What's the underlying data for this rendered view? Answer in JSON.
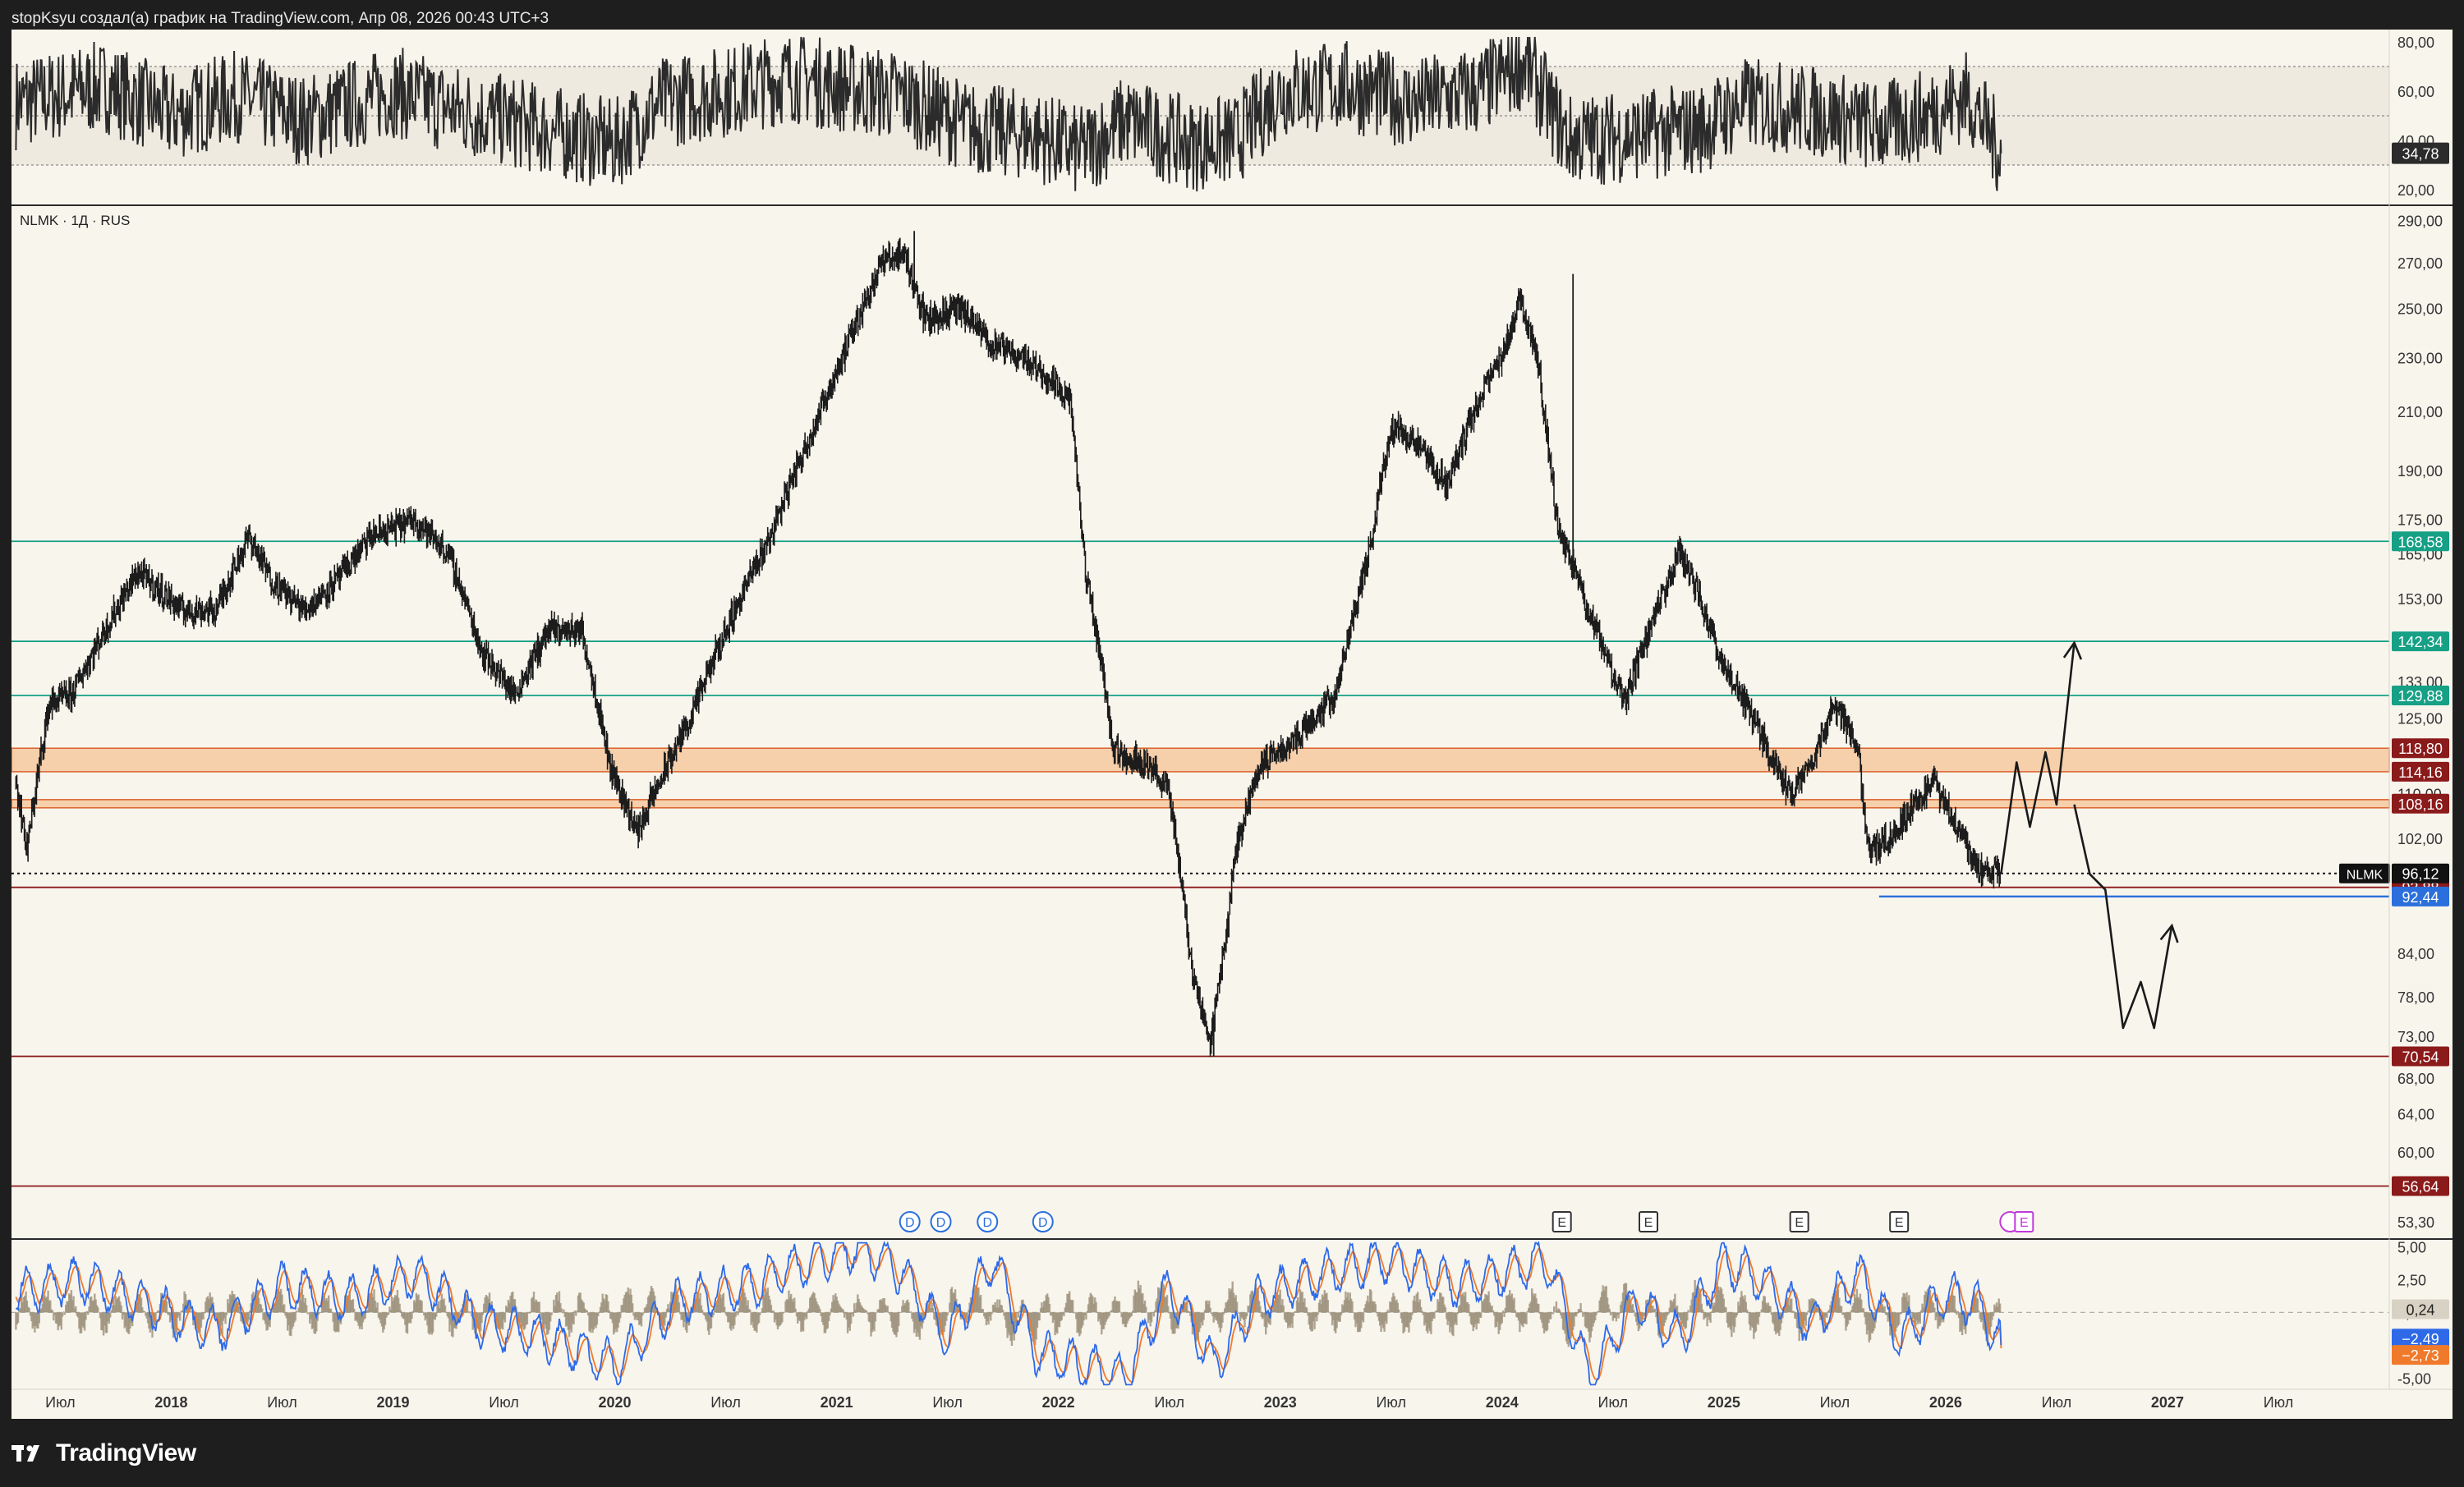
{
  "header": {
    "text": "stopKsyu создал(а) график на TradingView.com, Апр 08, 2026 00:43 UTC+3"
  },
  "footer": {
    "brand": "TradingView"
  },
  "main_legend": "NLMK · 1Д · RUS",
  "colors": {
    "background": "#f8f5ed",
    "candles": "#1c1c1c",
    "support_teal": "#16a085",
    "resistance_red": "#8b1a1a",
    "zone_orange": "#f5a15c",
    "blue_line": "#2a6fdb",
    "macd_line": "#2e6ae8",
    "signal_line": "#f07a2b",
    "histogram": "#9b9079"
  },
  "chart_data": [
    {
      "type": "line",
      "panel": "rsi",
      "y_ticks": [
        "80,00",
        "60,00",
        "40,00",
        "20,00"
      ],
      "ylim": [
        15,
        85
      ],
      "bands": [
        70,
        50,
        30
      ],
      "current_label": "34,78",
      "current_value": 34.78,
      "anchors_x": [
        2017.3,
        2017.7,
        2018.0,
        2018.3,
        2018.6,
        2019.0,
        2019.3,
        2019.6,
        2020.0,
        2020.2,
        2020.5,
        2020.8,
        2021.0,
        2021.3,
        2021.6,
        2021.9,
        2022.1,
        2022.3,
        2022.6,
        2022.8,
        2023.0,
        2023.3,
        2023.6,
        2023.9,
        2024.1,
        2024.3,
        2024.6,
        2024.9,
        2025.1,
        2025.4,
        2025.7,
        2025.9,
        2026.1,
        2026.25
      ],
      "anchors_y": [
        55,
        62,
        50,
        58,
        48,
        60,
        52,
        46,
        38,
        55,
        60,
        66,
        62,
        58,
        45,
        42,
        35,
        48,
        38,
        40,
        60,
        62,
        55,
        60,
        72,
        40,
        42,
        45,
        55,
        52,
        45,
        50,
        58,
        34.78
      ]
    },
    {
      "type": "candlestick",
      "panel": "price",
      "symbol": "NLMK",
      "timeframe": "1Д",
      "exchange": "RUS",
      "y_ticks": [
        "290,00",
        "270,00",
        "250,00",
        "230,00",
        "210,00",
        "190,00",
        "175,00",
        "165,00",
        "153,00",
        "143,00",
        "133,00",
        "125,00",
        "110,00",
        "102,00",
        "84,00",
        "78,00",
        "73,00",
        "68,00",
        "64,00",
        "60,00",
        "53,30"
      ],
      "y_tick_values": [
        290,
        270,
        250,
        230,
        210,
        190,
        175,
        165,
        153,
        143,
        133,
        125,
        110,
        102,
        84,
        78,
        73,
        68,
        64,
        60,
        53.3
      ],
      "ylim": [
        52,
        296
      ],
      "scale": "log",
      "x_ticks": [
        "Июл",
        "2018",
        "Июл",
        "2019",
        "Июл",
        "2020",
        "Июл",
        "2021",
        "Июл",
        "2022",
        "Июл",
        "2023",
        "Июл",
        "2024",
        "Июл",
        "2025",
        "Июл",
        "2026",
        "Июл",
        "2027",
        "Июл"
      ],
      "x_tick_values": [
        2017.5,
        2018.0,
        2018.5,
        2019.0,
        2019.5,
        2020.0,
        2020.5,
        2021.0,
        2021.5,
        2022.0,
        2022.5,
        2023.0,
        2023.5,
        2024.0,
        2024.5,
        2025.0,
        2025.5,
        2026.0,
        2026.5,
        2027.0,
        2027.5
      ],
      "x_bold": [
        false,
        true,
        false,
        true,
        false,
        true,
        false,
        true,
        false,
        true,
        false,
        true,
        false,
        true,
        false,
        true,
        false,
        true,
        false,
        true,
        false
      ],
      "xlim": [
        2017.28,
        2028.0
      ],
      "current": {
        "symbol": "NLMK",
        "label": "96,12",
        "value": 96.12
      },
      "anchors_x": [
        2017.3,
        2017.35,
        2017.45,
        2017.55,
        2017.7,
        2017.85,
        2018.05,
        2018.2,
        2018.35,
        2018.45,
        2018.6,
        2018.75,
        2018.9,
        2019.1,
        2019.25,
        2019.4,
        2019.55,
        2019.7,
        2019.85,
        2019.98,
        2020.1,
        2020.2,
        2020.35,
        2020.5,
        2020.7,
        2020.9,
        2021.05,
        2021.2,
        2021.3,
        2021.4,
        2021.55,
        2021.7,
        2021.85,
        2022.05,
        2022.12,
        2022.16,
        2022.25,
        2022.4,
        2022.5,
        2022.6,
        2022.68,
        2022.75,
        2022.8,
        2022.9,
        2023.05,
        2023.25,
        2023.4,
        2023.5,
        2023.6,
        2023.75,
        2023.9,
        2024.0,
        2024.08,
        2024.16,
        2024.22,
        2024.25,
        2024.3,
        2024.4,
        2024.55,
        2024.7,
        2024.8,
        2024.9,
        2025.0,
        2025.1,
        2025.2,
        2025.3,
        2025.4,
        2025.5,
        2025.6,
        2025.65,
        2025.75,
        2025.85,
        2025.95,
        2026.05,
        2026.15,
        2026.25
      ],
      "anchors_y": [
        112,
        100,
        128,
        130,
        145,
        160,
        150,
        150,
        170,
        158,
        150,
        158,
        170,
        175,
        165,
        140,
        130,
        145,
        145,
        115,
        103,
        112,
        126,
        145,
        170,
        205,
        235,
        270,
        275,
        245,
        250,
        235,
        230,
        215,
        160,
        148,
        118,
        116,
        110,
        82,
        72,
        85,
        100,
        115,
        120,
        130,
        165,
        205,
        200,
        185,
        215,
        230,
        255,
        230,
        190,
        172,
        165,
        148,
        128,
        150,
        166,
        152,
        136,
        128,
        118,
        110,
        116,
        128,
        120,
        100,
        102,
        108,
        112,
        104,
        96.5,
        96.12
      ],
      "spikes": [
        {
          "x": 2022.7,
          "low": 70.54
        },
        {
          "x": 2024.32,
          "high": 265
        },
        {
          "x": 2021.35,
          "high": 285
        }
      ],
      "zones": [
        {
          "from": 114.16,
          "to": 118.8,
          "label_top": "118,80",
          "label_bottom": "114,16"
        },
        {
          "from": 107.4,
          "to": 108.9,
          "label": "108,16"
        }
      ],
      "hlines": [
        {
          "value": 168.58,
          "label": "168,58",
          "style": "support"
        },
        {
          "value": 142.34,
          "label": "142,34",
          "style": "support"
        },
        {
          "value": 129.88,
          "label": "129,88",
          "style": "support"
        },
        {
          "value": 93.88,
          "label": "93,88",
          "style": "resistance"
        },
        {
          "value": 70.54,
          "label": "70,54",
          "style": "resistance"
        },
        {
          "value": 56.64,
          "label": "56,64",
          "style": "resistance"
        }
      ],
      "blue_line": {
        "value": 92.44,
        "label": "92,44",
        "x_from": 2025.7,
        "x_to": 2028.0
      },
      "forecast_path_1": {
        "x": [
          2026.25,
          2026.32,
          2026.38,
          2026.45,
          2026.5,
          2026.58
        ],
        "y": [
          96.12,
          116,
          104,
          118,
          108,
          142
        ]
      },
      "forecast_path_2": {
        "x": [
          2026.58,
          2026.65,
          2026.72,
          2026.8,
          2026.88,
          2026.94,
          2027.02
        ],
        "y": [
          108,
          96,
          93.5,
          74,
          80,
          74,
          88
        ]
      },
      "event_markers": [
        {
          "x": 2021.33,
          "label": "D",
          "kind": "dividend"
        },
        {
          "x": 2021.47,
          "label": "D",
          "kind": "dividend"
        },
        {
          "x": 2021.68,
          "label": "D",
          "kind": "dividend"
        },
        {
          "x": 2021.93,
          "label": "D",
          "kind": "dividend"
        },
        {
          "x": 2024.27,
          "label": "E",
          "kind": "earnings"
        },
        {
          "x": 2024.66,
          "label": "E",
          "kind": "earnings"
        },
        {
          "x": 2025.34,
          "label": "E",
          "kind": "earnings"
        },
        {
          "x": 2025.79,
          "label": "E",
          "kind": "earnings"
        },
        {
          "x": 2026.32,
          "label": "E",
          "kind": "earnings-dividend"
        }
      ]
    },
    {
      "type": "line",
      "panel": "macd",
      "y_ticks": [
        "5,00",
        "2,50",
        "0,00",
        "-5,00"
      ],
      "y_tick_values": [
        5,
        2.5,
        0,
        -5
      ],
      "ylim": [
        -5.6,
        5.4
      ],
      "labels": {
        "histogram": "0,24",
        "macd": "−2,49",
        "signal": "−2,73"
      },
      "values": {
        "histogram": 0.24,
        "macd": -2.49,
        "signal": -2.73
      },
      "anchors_x": [
        2017.3,
        2017.6,
        2017.9,
        2018.2,
        2018.5,
        2018.8,
        2019.1,
        2019.4,
        2019.7,
        2020.0,
        2020.3,
        2020.6,
        2020.9,
        2021.1,
        2021.3,
        2021.5,
        2021.7,
        2021.9,
        2022.1,
        2022.3,
        2022.5,
        2022.7,
        2022.9,
        2023.2,
        2023.5,
        2023.8,
        2024.0,
        2024.2,
        2024.4,
        2024.6,
        2024.8,
        2025.0,
        2025.2,
        2025.4,
        2025.6,
        2025.8,
        2026.0,
        2026.15,
        2026.25
      ],
      "anchors_y": [
        1.5,
        2.5,
        0.5,
        -1.5,
        2,
        1,
        3,
        -1,
        -2,
        -4,
        1,
        2,
        4,
        5,
        3,
        -2,
        4,
        -3,
        -4,
        -5,
        2,
        -4,
        1,
        3,
        4,
        2,
        3,
        4,
        -5,
        1,
        -2,
        4,
        2,
        -1,
        3,
        -2,
        1.5,
        0.5,
        -2.49
      ]
    }
  ]
}
